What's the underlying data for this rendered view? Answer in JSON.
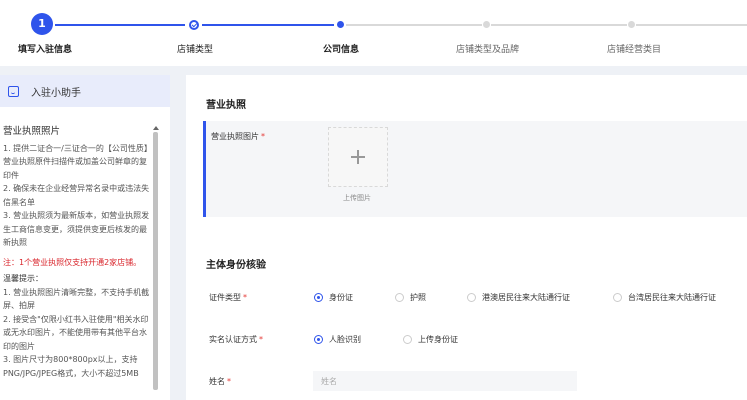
{
  "stepper": {
    "step1_number": "1",
    "steps": [
      "填写入驻信息",
      "店铺类型",
      "公司信息",
      "店铺类型及品牌",
      "店铺经营类目"
    ],
    "active_color": "#2f54eb",
    "inactive_color": "#d9d9d9"
  },
  "assistant": {
    "title": "入驻小助手",
    "section_title": "营业执照照片",
    "items": [
      "1. 提供二证合一/三证合一的【公司性质】营业执照原件扫描件或加盖公司鲜章的复印件",
      "2. 确保未在企业经营异常名录中或违法失信黑名单",
      "3. 营业执照须为最新版本，如营业执照发生工商信息变更，须提供变更后核发的最新执照"
    ],
    "note": "注：1个营业执照仅支持开通2家店铺。",
    "tips_title": "温馨提示：",
    "tips": [
      "1. 营业执照图片清晰完整，不支持手机截屏、拍屏",
      "2. 接受含\"仅限小红书入驻使用\"相关水印或无水印图片，不能使用带有其他平台水印的图片",
      "3. 图片尺寸为800*800px以上，支持PNG/JPG/JPEG格式，大小不超过5MB"
    ]
  },
  "form": {
    "license_section": "营业执照",
    "license_image_label": "营业执照图片",
    "upload_text": "上传图片",
    "identity_section": "主体身份核验",
    "id_type_label": "证件类型",
    "id_types": [
      "身份证",
      "护照",
      "港澳居民往来大陆通行证",
      "台湾居民往来大陆通行证"
    ],
    "id_type_selected": "身份证",
    "verify_label": "实名认证方式",
    "verify_methods": [
      "人脸识别",
      "上传身份证"
    ],
    "verify_selected": "人脸识别",
    "name_label": "姓名",
    "name_placeholder": "姓名",
    "required_mark": "*"
  }
}
